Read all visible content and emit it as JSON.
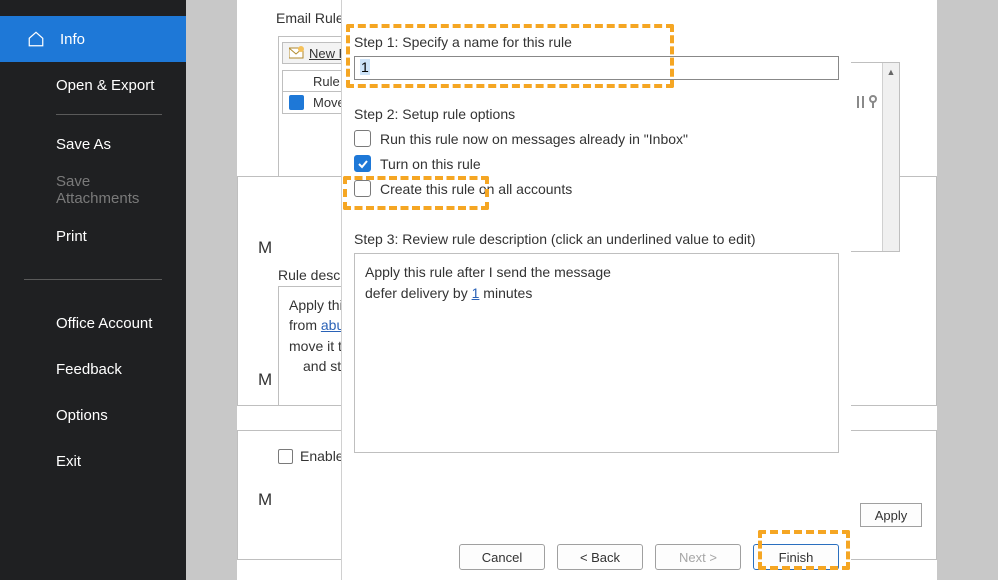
{
  "sidebar": {
    "info": "Info",
    "open_export": "Open & Export",
    "save_as": "Save As",
    "save_attachments": "Save Attachments",
    "print": "Print",
    "office_account": "Office Account",
    "feedback": "Feedback",
    "options": "Options",
    "exit": "Exit"
  },
  "back": {
    "email_rules_label": "Email Rules",
    "new_rule_label": "New R",
    "rules_header_rule": "Rule (",
    "rules_row_move": "Move",
    "rule_desc_label": "Rule descr",
    "rule_desc_line1_pre": "Apply this",
    "rule_desc_line2_pre": "from ",
    "rule_desc_line2_link": "abu",
    "rule_desc_line3": "move it t",
    "rule_desc_line4": "and sto",
    "enable_label": "Enable",
    "m1": "M",
    "m2": "M",
    "m3": "M",
    "apply": "Apply"
  },
  "wizard": {
    "step1_label": "Step 1: Specify a name for this rule",
    "name_value": "1",
    "step2_label": "Step 2: Setup rule options",
    "opt_run_now": "Run this rule now on messages already in \"Inbox\"",
    "opt_turn_on": "Turn on this rule",
    "opt_all_accounts": "Create this rule on all accounts",
    "step3_label": "Step 3: Review rule description (click an underlined value to edit)",
    "review_l1": "Apply this rule after I send the message",
    "review_l2_pre": "defer delivery by ",
    "review_l2_link": "1",
    "review_l2_post": " minutes",
    "btn_cancel": "Cancel",
    "btn_back": "< Back",
    "btn_next": "Next >",
    "btn_finish": "Finish"
  }
}
